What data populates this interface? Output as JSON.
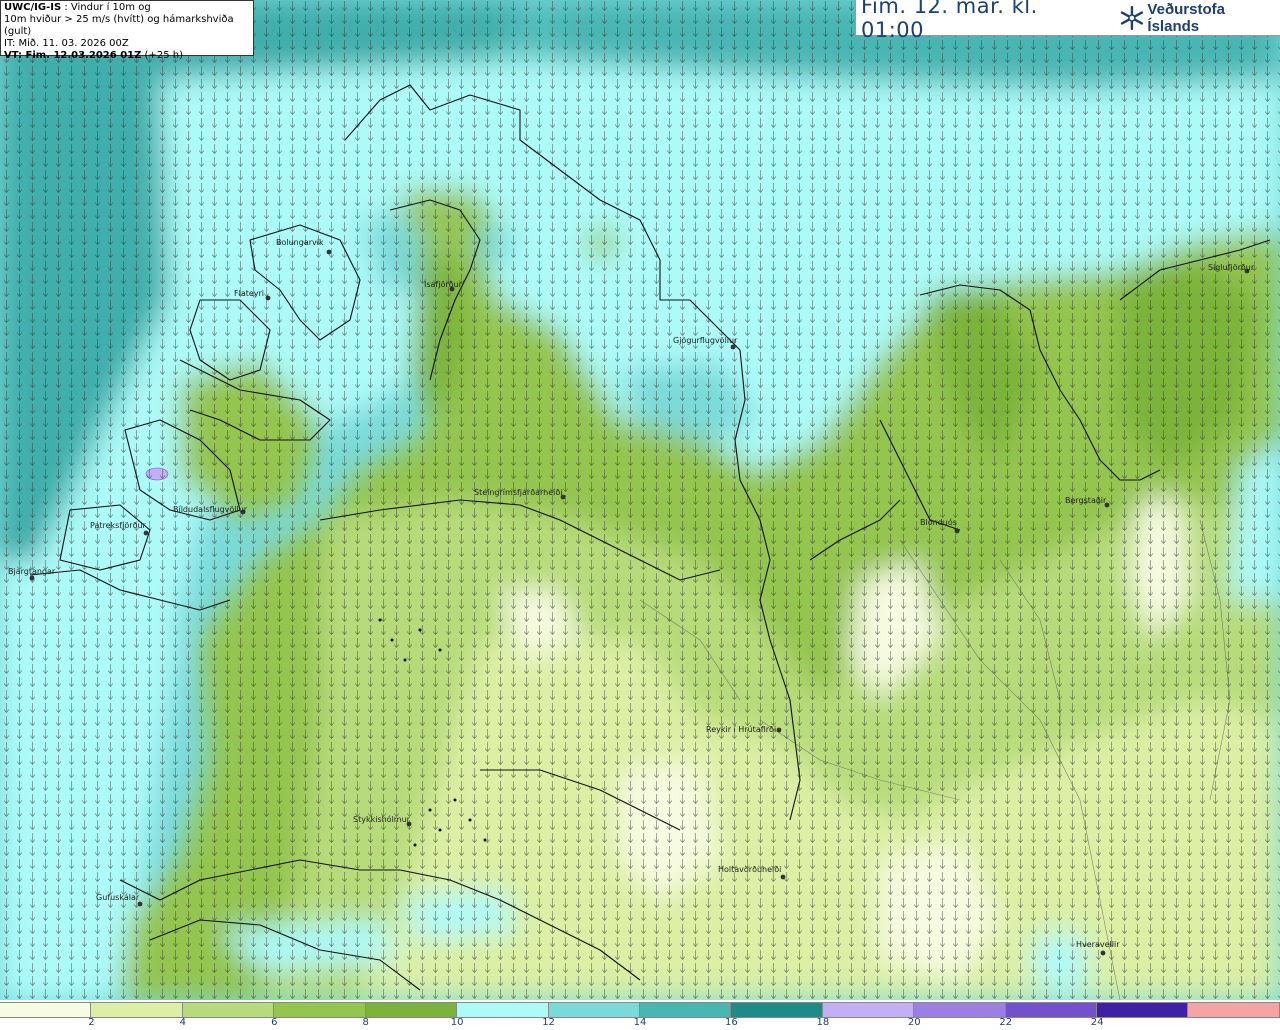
{
  "info": {
    "line1_bold": "UWC/IG-IS",
    "line1_rest": " : Vindur í 10m og",
    "line2": "10m hviður > 25 m/s (hvítt) og hámarkshviða (gult)",
    "line3": "IT: Mið. 11. 03. 2026 00Z",
    "line4_bold": "VT: Fim. 12.03.2026 01Z",
    "line4_rest": " (+25 h)"
  },
  "header": {
    "valid_time": "Fim. 12. mar. kl. 01:00",
    "logo_text": "Veðurstofa Íslands",
    "logo_icon": "snowflake-logo-icon"
  },
  "places": [
    {
      "name": "Bolungarvík"
    },
    {
      "name": "Flateyri"
    },
    {
      "name": "Ísafjörður"
    },
    {
      "name": "Gjögurflugvöllur"
    },
    {
      "name": "Patreksfjörður"
    },
    {
      "name": "Bíldudalsflugvöllur"
    },
    {
      "name": "Bjargtangar"
    },
    {
      "name": "Steingrímsfjarðarheiði"
    },
    {
      "name": "Siglufjörður"
    },
    {
      "name": "Bergstaðir"
    },
    {
      "name": "Blönduós"
    },
    {
      "name": "Reykir í Hrútafirði"
    },
    {
      "name": "Stykkishólmur"
    },
    {
      "name": "Holtavörðuheiði"
    },
    {
      "name": "Gufuskálar"
    },
    {
      "name": "Hveravellir"
    }
  ],
  "legend": {
    "unit": "m/s",
    "colors": [
      "#f7fbe1",
      "#dcefa4",
      "#b7db7a",
      "#94c54f",
      "#7cb33b",
      "#adfbf9",
      "#7bdad9",
      "#48b6b3",
      "#1d8b88",
      "#c3b0f4",
      "#9b7fe2",
      "#7350cc",
      "#3e22a3",
      "#f6a3a3"
    ],
    "ticks": [
      "2",
      "4",
      "6",
      "8",
      "10",
      "12",
      "14",
      "16",
      "18",
      "20",
      "22",
      "24"
    ]
  }
}
